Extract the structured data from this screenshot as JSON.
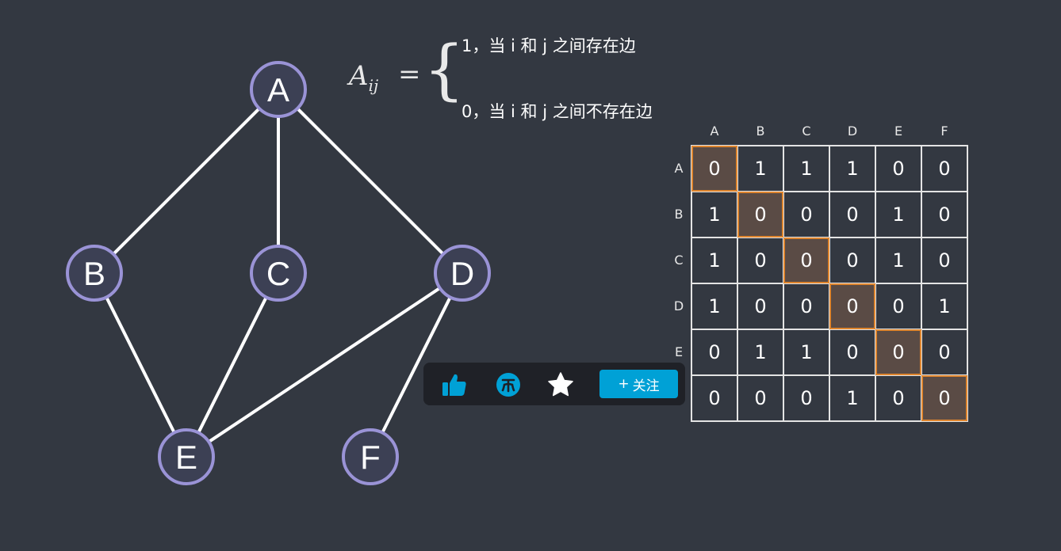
{
  "formula": {
    "lhs_symbol": "A",
    "lhs_subscript": "ij",
    "equals": "=",
    "brace": "{",
    "case_edge": "1，当 i 和 j 之间存在边",
    "case_no_edge": "0，当 i 和 j 之间不存在边"
  },
  "graph": {
    "nodes": [
      {
        "id": "A",
        "label": "A"
      },
      {
        "id": "B",
        "label": "B"
      },
      {
        "id": "C",
        "label": "C"
      },
      {
        "id": "D",
        "label": "D"
      },
      {
        "id": "E",
        "label": "E"
      },
      {
        "id": "F",
        "label": "F"
      }
    ],
    "edges": [
      [
        "A",
        "B"
      ],
      [
        "A",
        "C"
      ],
      [
        "A",
        "D"
      ],
      [
        "B",
        "E"
      ],
      [
        "C",
        "E"
      ],
      [
        "D",
        "E"
      ],
      [
        "D",
        "F"
      ]
    ],
    "node_fill": "#3c4054",
    "node_stroke": "#9a93d6",
    "edge_color": "#ffffff"
  },
  "matrix": {
    "col_headers": [
      "A",
      "B",
      "C",
      "D",
      "E",
      "F"
    ],
    "row_headers": [
      "A",
      "B",
      "C",
      "D",
      "E",
      "F"
    ],
    "rows": [
      [
        "0",
        "1",
        "1",
        "1",
        "0",
        "0"
      ],
      [
        "1",
        "0",
        "0",
        "0",
        "1",
        "0"
      ],
      [
        "1",
        "0",
        "0",
        "0",
        "1",
        "0"
      ],
      [
        "1",
        "0",
        "0",
        "0",
        "0",
        "1"
      ],
      [
        "0",
        "1",
        "1",
        "0",
        "0",
        "0"
      ],
      [
        "0",
        "0",
        "0",
        "1",
        "0",
        "0"
      ]
    ],
    "diagonal_highlight_color": "#e0862e"
  },
  "toolbar": {
    "follow_plus": "+",
    "follow_label": "关注",
    "accent": "#00a1d6"
  }
}
